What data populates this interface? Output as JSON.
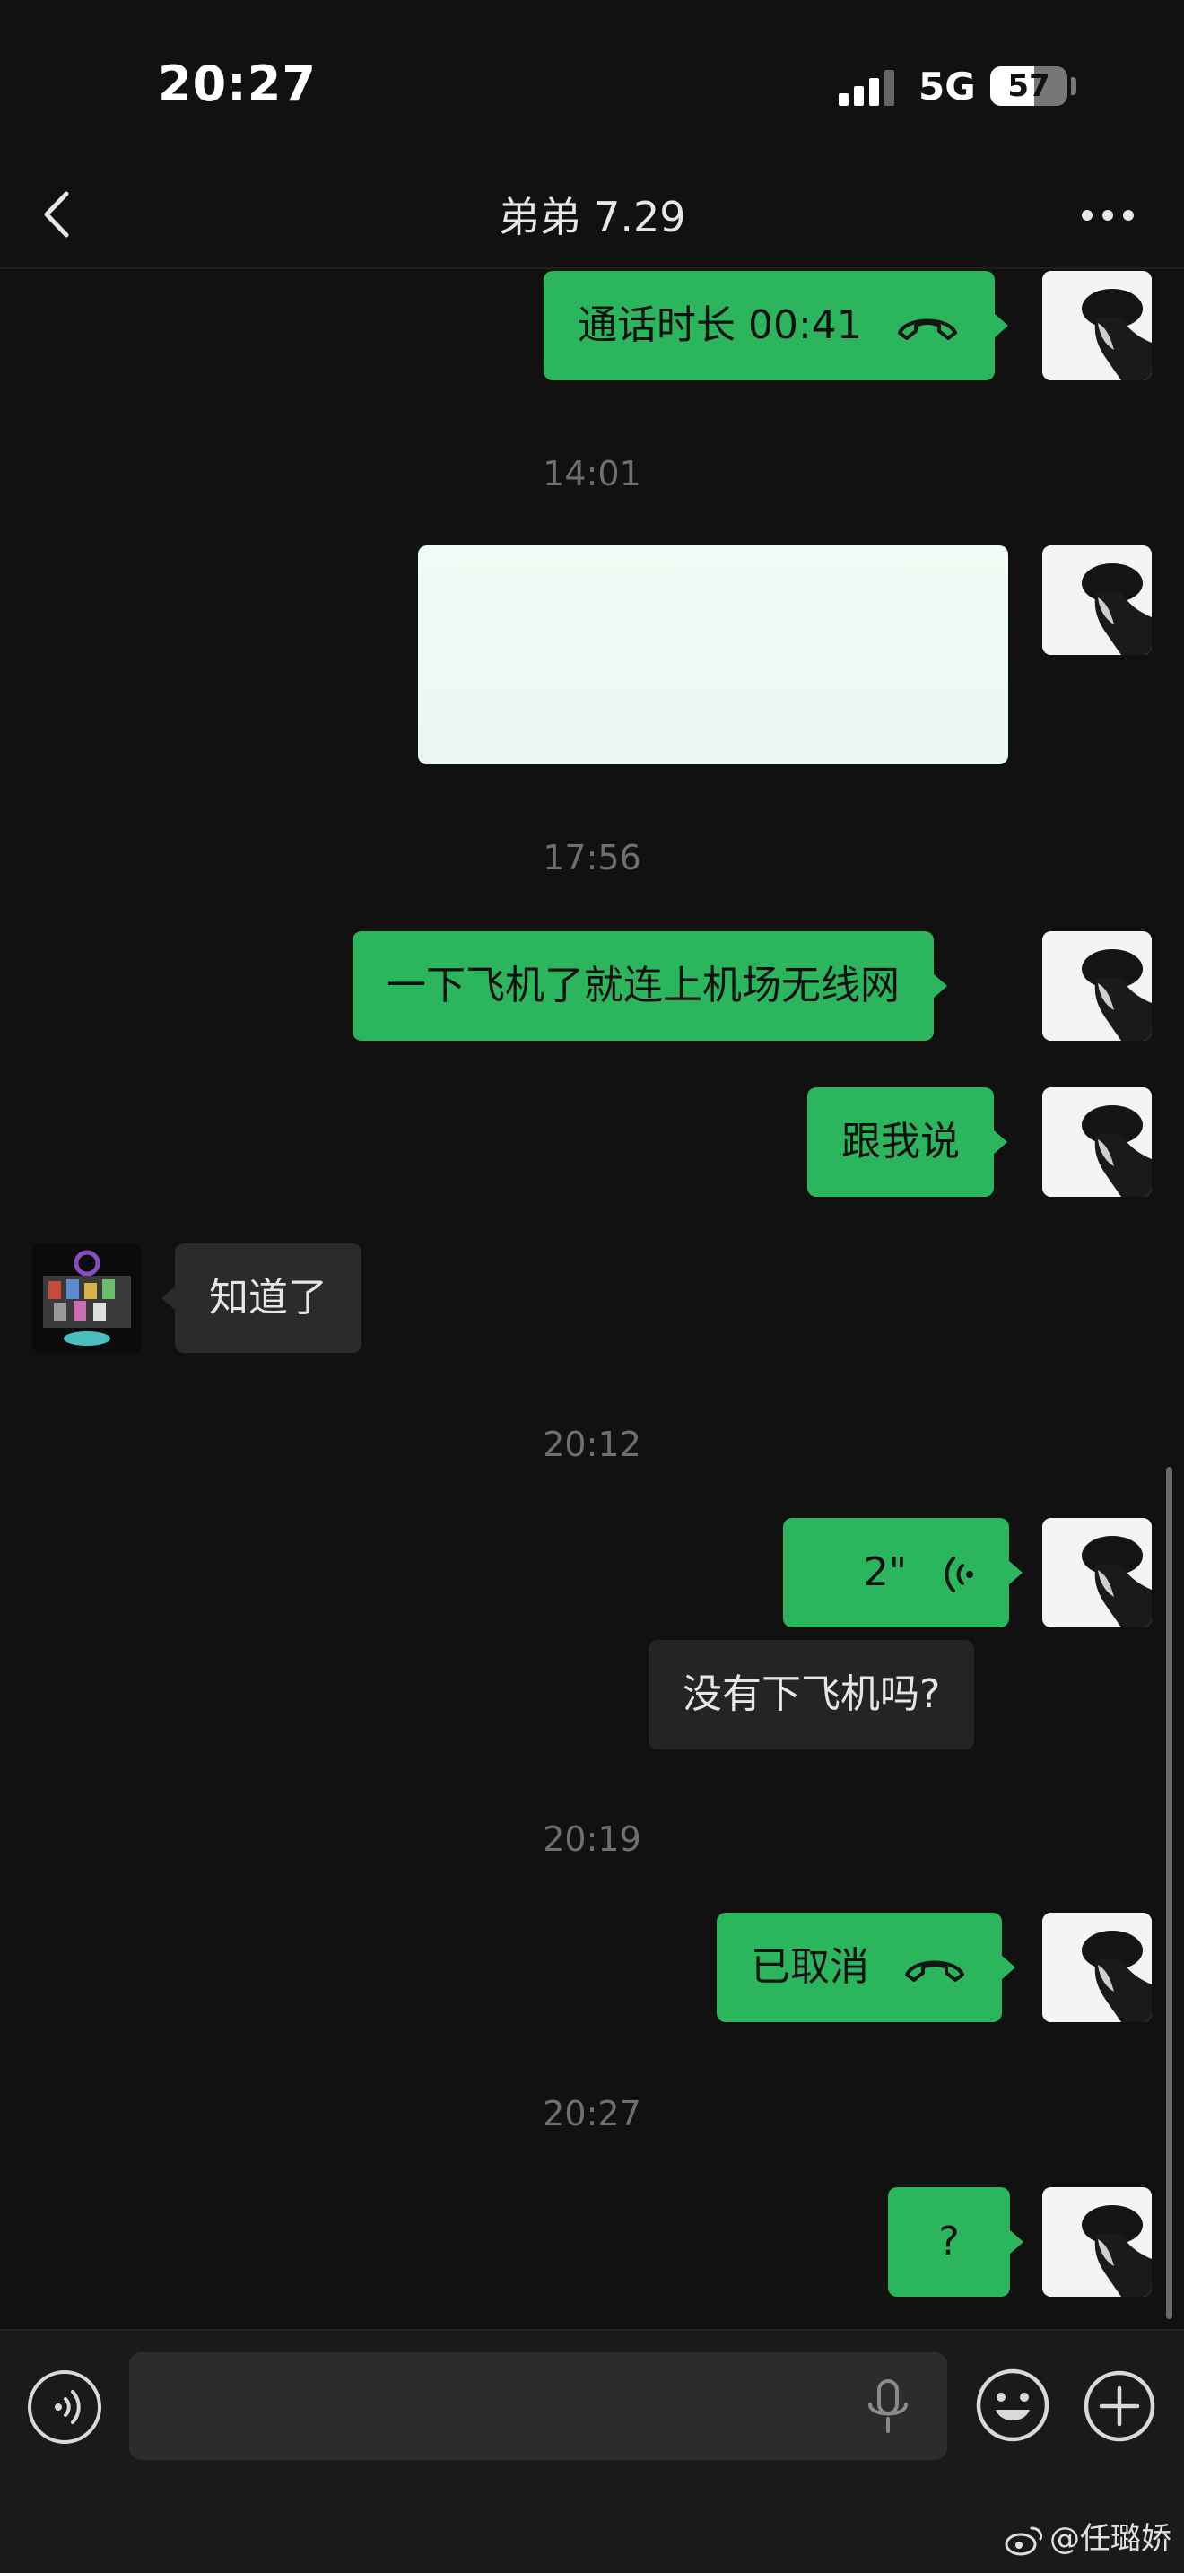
{
  "status_bar": {
    "time": "20:27",
    "network": "5G",
    "battery_percent": 57,
    "battery_text": "57",
    "signal_icon": "cellular-signal-icon"
  },
  "nav": {
    "title": "弟弟 7.29",
    "back_icon": "chevron-left-icon",
    "more_icon": "more-dots-icon"
  },
  "messages": [
    {
      "type": "call",
      "sender": "self",
      "text": "通话时长 00:41",
      "icon": "phone-hangup-icon"
    },
    {
      "type": "timestamp",
      "text": "14:01"
    },
    {
      "type": "image",
      "sender": "self"
    },
    {
      "type": "timestamp",
      "text": "17:56"
    },
    {
      "type": "text",
      "sender": "self",
      "text": "一下飞机了就连上机场无线网"
    },
    {
      "type": "text",
      "sender": "self",
      "text": "跟我说"
    },
    {
      "type": "text",
      "sender": "other",
      "text": "知道了"
    },
    {
      "type": "timestamp",
      "text": "20:12"
    },
    {
      "type": "voice",
      "sender": "self",
      "text": "2\"",
      "icon": "voice-wave-icon"
    },
    {
      "type": "transcription",
      "sender": "self",
      "text": "没有下飞机吗?"
    },
    {
      "type": "timestamp",
      "text": "20:19"
    },
    {
      "type": "call",
      "sender": "self",
      "text": "已取消",
      "icon": "phone-hangup-icon"
    },
    {
      "type": "timestamp",
      "text": "20:27"
    },
    {
      "type": "text",
      "sender": "self",
      "text": "?"
    }
  ],
  "input_bar": {
    "voice_icon": "voice-toggle-icon",
    "input_value": "",
    "mic_icon": "microphone-icon",
    "emoji_icon": "emoji-icon",
    "plus_icon": "plus-icon"
  },
  "watermark": {
    "icon": "weibo-icon",
    "text": "@任璐娇"
  },
  "colors": {
    "background": "#111111",
    "self_bubble": "#2bb55c",
    "other_bubble": "#2b2b2b",
    "timestamp": "#6f6f6f"
  }
}
